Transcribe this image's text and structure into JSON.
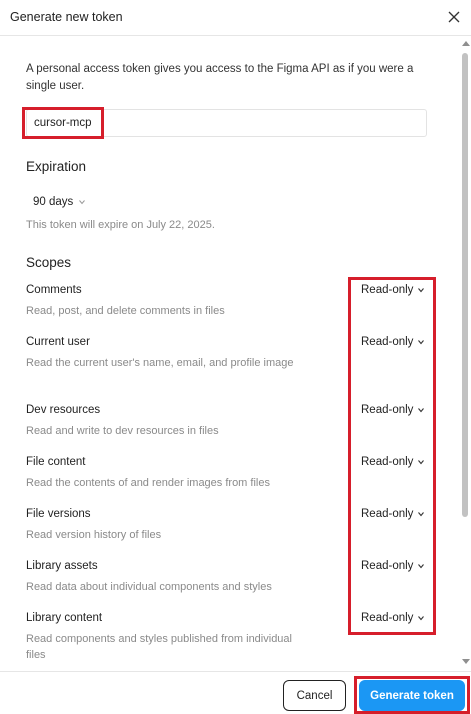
{
  "dialog": {
    "title": "Generate new token"
  },
  "intro": {
    "text": "A personal access token gives you access to the Figma API as if you were a single user."
  },
  "token_name": {
    "value": "cursor-mcp"
  },
  "expiration": {
    "heading": "Expiration",
    "selected": "90 days",
    "note": "This token will expire on July 22, 2025."
  },
  "scopes": {
    "heading": "Scopes",
    "items": [
      {
        "name": "Comments",
        "description": "Read, post, and delete comments in files",
        "permission": "Read-only"
      },
      {
        "name": "Current user",
        "description": "Read the current user's name, email, and profile image",
        "permission": "Read-only"
      },
      {
        "name": "Dev resources",
        "description": "Read and write to dev resources in files",
        "permission": "Read-only"
      },
      {
        "name": "File content",
        "description": "Read the contents of and render images from files",
        "permission": "Read-only"
      },
      {
        "name": "File versions",
        "description": "Read version history of files",
        "permission": "Read-only"
      },
      {
        "name": "Library assets",
        "description": "Read data about individual components and styles",
        "permission": "Read-only"
      },
      {
        "name": "Library content",
        "description": "Read components and styles published from individual files",
        "permission": "Read-only"
      }
    ]
  },
  "footer": {
    "cancel_label": "Cancel",
    "generate_label": "Generate token"
  },
  "colors": {
    "primary": "#1b97f4",
    "highlight": "#d61e2b"
  },
  "icons": {
    "close": "close-icon",
    "chevron": "chevron-down-icon"
  }
}
